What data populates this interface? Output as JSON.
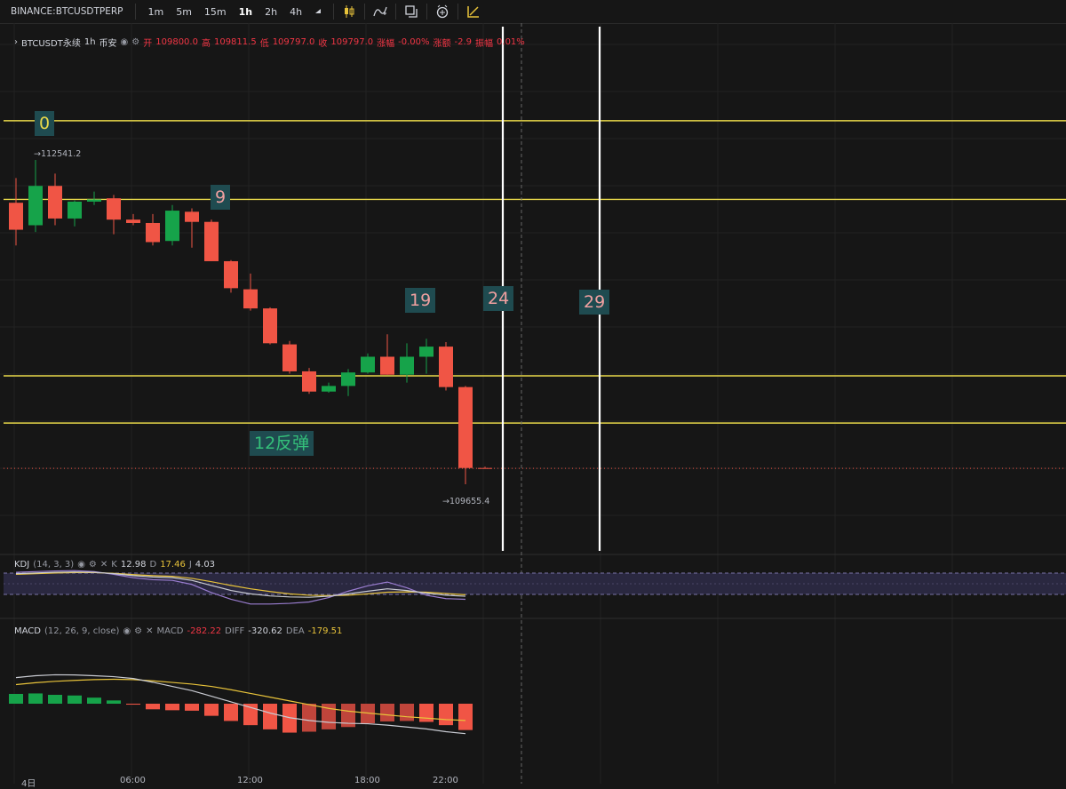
{
  "toolbar": {
    "symbol": "BINANCE:BTCUSDTPERP",
    "timeframes": [
      "1m",
      "5m",
      "15m",
      "1h",
      "2h",
      "4h"
    ],
    "active_timeframe": "1h",
    "dropdown_icon": "caret-down-icon",
    "tools": [
      "candlestick-icon",
      "indicator-icon",
      "compare-icon",
      "alert-icon",
      "drawing-icon"
    ]
  },
  "legend": {
    "name": "BTCUSDT永续",
    "interval": "1h",
    "exchange": "币安",
    "open_label": "开",
    "open": "109800.0",
    "high_label": "高",
    "high": "109811.5",
    "low_label": "低",
    "low": "109797.0",
    "close_label": "收",
    "close": "109797.0",
    "change_pct_label": "涨幅",
    "change_pct": "-0.00%",
    "change_label": "涨额",
    "change": "-2.9",
    "amplitude_label": "振幅",
    "amplitude": "0.01%"
  },
  "price_markers": {
    "high": "→112541.2",
    "low": "→109655.4"
  },
  "annotations": [
    {
      "text": "0",
      "color": "#e8d84a"
    },
    {
      "text": "9",
      "color": "#f0a0a0"
    },
    {
      "text": "19",
      "color": "#f0a0a0"
    },
    {
      "text": "24",
      "color": "#f0a0a0"
    },
    {
      "text": "29",
      "color": "#f0a0a0"
    },
    {
      "text": "12反弹",
      "color": "#34c07a"
    }
  ],
  "kdj": {
    "name": "KDJ",
    "params": "(14, 3, 3)",
    "k_label": "K",
    "k": "12.98",
    "d_label": "D",
    "d": "17.46",
    "j_label": "J",
    "j": "4.03"
  },
  "macd": {
    "name": "MACD",
    "params": "(12, 26, 9, close)",
    "macd_label": "MACD",
    "macd": "-282.22",
    "diff_label": "DIFF",
    "diff": "-320.62",
    "dea_label": "DEA",
    "dea": "-179.51"
  },
  "time_axis": [
    "4日",
    "06:00",
    "12:00",
    "18:00",
    "22:00"
  ],
  "colors": {
    "up": "#26a69a",
    "bull": "#16a34a",
    "bear": "#f05545",
    "hline": "#e8d84a",
    "vline": "#ffffff"
  },
  "chart_data": {
    "type": "candlestick",
    "candles": [
      {
        "o": 112160,
        "h": 112380,
        "l": 111780,
        "c": 111920
      },
      {
        "o": 111960,
        "h": 112541.2,
        "l": 111900,
        "c": 112310
      },
      {
        "o": 112310,
        "h": 112420,
        "l": 111960,
        "c": 112020
      },
      {
        "o": 112020,
        "h": 112180,
        "l": 111950,
        "c": 112170
      },
      {
        "o": 112170,
        "h": 112260,
        "l": 112140,
        "c": 112190
      },
      {
        "o": 112200,
        "h": 112230,
        "l": 111880,
        "c": 112010
      },
      {
        "o": 112010,
        "h": 112060,
        "l": 111960,
        "c": 111980
      },
      {
        "o": 111980,
        "h": 112060,
        "l": 111780,
        "c": 111810
      },
      {
        "o": 111820,
        "h": 112140,
        "l": 111780,
        "c": 112090
      },
      {
        "o": 112080,
        "h": 112110,
        "l": 111760,
        "c": 111990
      },
      {
        "o": 111990,
        "h": 112010,
        "l": 111640,
        "c": 111640
      },
      {
        "o": 111640,
        "h": 111650,
        "l": 111360,
        "c": 111400
      },
      {
        "o": 111390,
        "h": 111530,
        "l": 111200,
        "c": 111220
      },
      {
        "o": 111220,
        "h": 111230,
        "l": 110900,
        "c": 110910
      },
      {
        "o": 110900,
        "h": 110930,
        "l": 110640,
        "c": 110660
      },
      {
        "o": 110660,
        "h": 110690,
        "l": 110460,
        "c": 110480
      },
      {
        "o": 110480,
        "h": 110560,
        "l": 110470,
        "c": 110530
      },
      {
        "o": 110530,
        "h": 110680,
        "l": 110440,
        "c": 110650
      },
      {
        "o": 110650,
        "h": 110820,
        "l": 110640,
        "c": 110790
      },
      {
        "o": 110790,
        "h": 110990,
        "l": 110630,
        "c": 110630
      },
      {
        "o": 110630,
        "h": 110910,
        "l": 110560,
        "c": 110790
      },
      {
        "o": 110790,
        "h": 110950,
        "l": 110640,
        "c": 110880
      },
      {
        "o": 110880,
        "h": 110920,
        "l": 110490,
        "c": 110520
      },
      {
        "o": 110520,
        "h": 110530,
        "l": 109655.4,
        "c": 109800
      },
      {
        "o": 109800,
        "h": 109811.5,
        "l": 109797,
        "c": 109797
      }
    ],
    "horizontal_levels": [
      112890,
      112190,
      110620,
      110200
    ],
    "kdj": {
      "k": [
        80,
        82,
        84,
        85,
        84,
        80,
        74,
        70,
        68,
        60,
        45,
        30,
        20,
        14,
        11,
        10,
        13,
        20,
        28,
        35,
        30,
        22,
        16,
        12.98
      ],
      "d": [
        78,
        80,
        82,
        83,
        83,
        81,
        77,
        74,
        72,
        66,
        56,
        45,
        35,
        27,
        20,
        16,
        15,
        16,
        20,
        25,
        26,
        25,
        21,
        17.46
      ],
      "j": [
        84,
        86,
        88,
        89,
        86,
        78,
        68,
        62,
        60,
        48,
        24,
        4,
        -10,
        -10,
        -8,
        -4,
        9,
        28,
        44,
        55,
        38,
        16,
        6,
        4.03
      ]
    },
    "macd": {
      "hist": [
        105,
        110,
        95,
        88,
        65,
        35,
        -10,
        -60,
        -70,
        -75,
        -130,
        -185,
        -230,
        -275,
        -310,
        -300,
        -275,
        -250,
        -210,
        -190,
        -185,
        -195,
        -230,
        -282.22
      ],
      "diff": [
        280,
        300,
        310,
        308,
        300,
        290,
        270,
        230,
        185,
        140,
        80,
        20,
        -40,
        -100,
        -150,
        -180,
        -200,
        -210,
        -215,
        -230,
        -250,
        -270,
        -300,
        -320.62
      ],
      "dea": [
        205,
        225,
        240,
        250,
        258,
        262,
        258,
        245,
        228,
        210,
        185,
        150,
        110,
        70,
        30,
        -10,
        -50,
        -80,
        -100,
        -120,
        -140,
        -155,
        -170,
        -179.51
      ]
    }
  }
}
